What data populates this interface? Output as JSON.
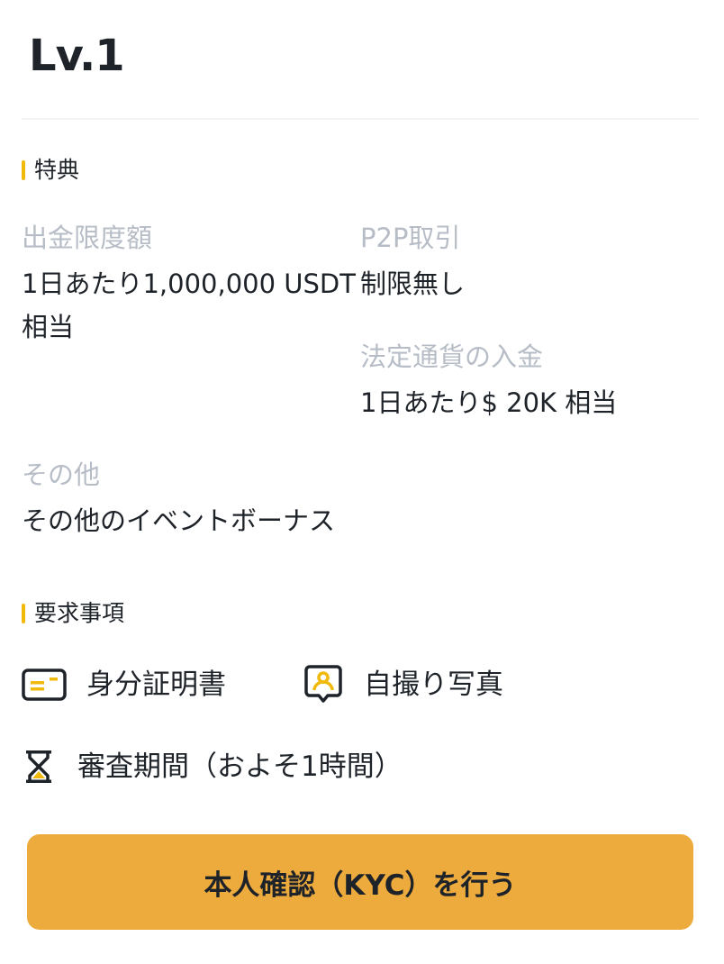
{
  "header": {
    "level": "Lv.1"
  },
  "benefits": {
    "heading": "特典",
    "withdrawal": {
      "label": "出金限度額",
      "value": "1日あたり1,000,000 USDT相当"
    },
    "p2p": {
      "label": "P2P取引",
      "value": "制限無し"
    },
    "fiat": {
      "label": "法定通貨の入金",
      "value": "1日あたり$ 20K 相当"
    },
    "other": {
      "label": "その他",
      "value": "その他のイベントボーナス"
    }
  },
  "requirements": {
    "heading": "要求事項",
    "items": [
      {
        "icon": "id-card-icon",
        "label": "身分証明書"
      },
      {
        "icon": "selfie-icon",
        "label": "自撮り写真"
      },
      {
        "icon": "hourglass-icon",
        "label": "審査期間（およそ1時間）"
      }
    ]
  },
  "action": {
    "kyc_label": "本人確認（KYC）を行う"
  },
  "colors": {
    "accent": "#f0b90b",
    "button": "#edaa3d",
    "muted": "#b7bdc6",
    "text": "#1e2329"
  }
}
